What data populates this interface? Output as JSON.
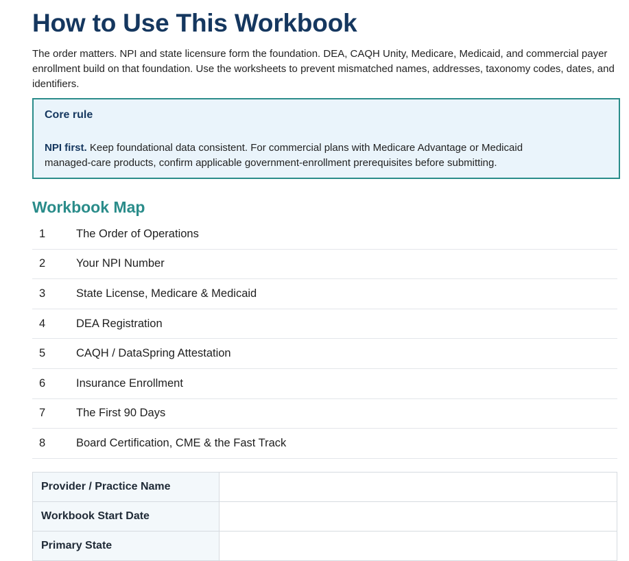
{
  "header": {
    "title": "How to Use This Workbook",
    "intro": "The order matters. NPI and state licensure form the foundation. DEA, CAQH Unity, Medicare, Medicaid, and commercial payer enrollment build on that foundation. Use the worksheets to prevent mismatched names, addresses, taxonomy codes, dates, and identifiers."
  },
  "callout": {
    "title": "Core rule",
    "lead": "NPI first.",
    "body": " Keep foundational data consistent. For commercial plans with Medicare Advantage or Medicaid managed-care products, confirm applicable government-enrollment prerequisites before submitting."
  },
  "workbook_map": {
    "title": "Workbook Map",
    "items": [
      {
        "number": "1",
        "label": "The Order of Operations"
      },
      {
        "number": "2",
        "label": "Your NPI Number"
      },
      {
        "number": "3",
        "label": "State License, Medicare & Medicaid"
      },
      {
        "number": "4",
        "label": "DEA Registration"
      },
      {
        "number": "5",
        "label": "CAQH / DataSpring Attestation"
      },
      {
        "number": "6",
        "label": "Insurance Enrollment"
      },
      {
        "number": "7",
        "label": "The First 90 Days"
      },
      {
        "number": "8",
        "label": "Board Certification, CME & the Fast Track"
      }
    ]
  },
  "info_table": {
    "rows": [
      {
        "label": "Provider / Practice Name",
        "value": ""
      },
      {
        "label": "Workbook Start Date",
        "value": ""
      },
      {
        "label": "Primary State",
        "value": ""
      }
    ]
  }
}
